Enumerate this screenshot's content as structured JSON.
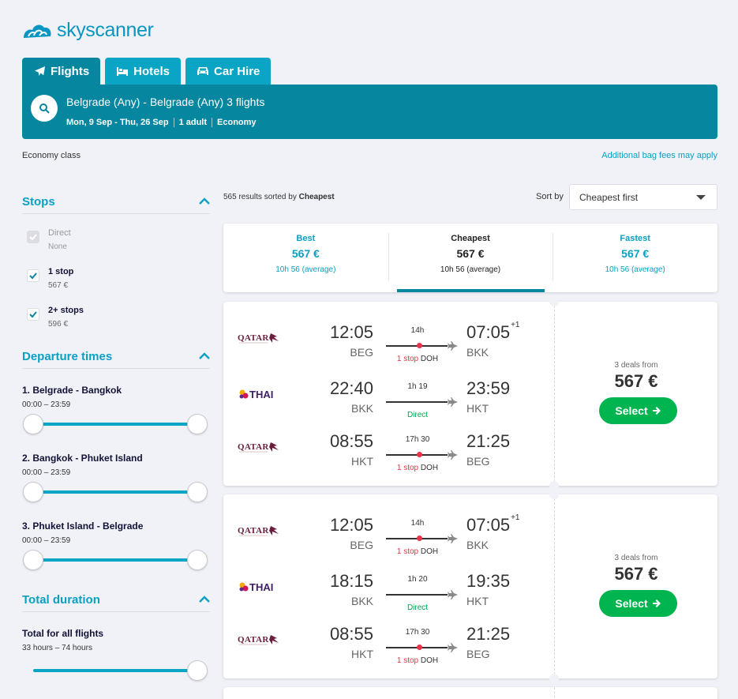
{
  "brand": {
    "name": "skyscanner",
    "color": "#0896c2"
  },
  "tabs": [
    {
      "label": "Flights",
      "icon": "plane-icon",
      "active": true
    },
    {
      "label": "Hotels",
      "icon": "bed-icon",
      "active": false
    },
    {
      "label": "Car Hire",
      "icon": "car-icon",
      "active": false
    }
  ],
  "search": {
    "route": "Belgrade (Any) - Belgrade (Any) 3 flights",
    "dates": "Mon, 9 Sep - Thu, 26 Sep",
    "travellers": "1 adult",
    "cabin": "Economy"
  },
  "notes": {
    "class": "Economy class",
    "bag_fees": "Additional bag fees may apply"
  },
  "filters": {
    "stops": {
      "title": "Stops",
      "options": [
        {
          "label": "Direct",
          "price": "None",
          "checked": true,
          "disabled": true
        },
        {
          "label": "1 stop",
          "price": "567 €",
          "checked": true,
          "disabled": false
        },
        {
          "label": "2+ stops",
          "price": "596 €",
          "checked": true,
          "disabled": false
        }
      ]
    },
    "departure": {
      "title": "Departure times",
      "legs": [
        {
          "label": "1. Belgrade - Bangkok",
          "range": "00:00 – 23:59"
        },
        {
          "label": "2. Bangkok - Phuket Island",
          "range": "00:00 – 23:59"
        },
        {
          "label": "3. Phuket Island - Belgrade",
          "range": "00:00 – 23:59"
        }
      ]
    },
    "duration": {
      "title": "Total duration",
      "label": "Total for all flights",
      "range": "33 hours – 74 hours"
    }
  },
  "results": {
    "count_prefix": "565 results sorted by",
    "sorted_by": "Cheapest",
    "sort_label": "Sort by",
    "sort_value": "Cheapest first"
  },
  "sort_tabs": [
    {
      "label": "Best",
      "price": "567 €",
      "duration": "10h 56 (average)",
      "active": false
    },
    {
      "label": "Cheapest",
      "price": "567 €",
      "duration": "10h 56 (average)",
      "active": true
    },
    {
      "label": "Fastest",
      "price": "567 €",
      "duration": "10h 56 (average)",
      "active": false
    }
  ],
  "itineraries": [
    {
      "deals": "3 deals from",
      "price": "567 €",
      "select": "Select",
      "legs": [
        {
          "airline": "QATAR",
          "dep_time": "12:05",
          "dep_airport": "BEG",
          "duration": "14h",
          "stops": "1 stop",
          "via": "DOH",
          "arr_time": "07:05",
          "plus": "+1",
          "arr_airport": "BKK"
        },
        {
          "airline": "THAI",
          "dep_time": "22:40",
          "dep_airport": "BKK",
          "duration": "1h 19",
          "stops": "Direct",
          "via": "",
          "arr_time": "23:59",
          "plus": "",
          "arr_airport": "HKT"
        },
        {
          "airline": "QATAR",
          "dep_time": "08:55",
          "dep_airport": "HKT",
          "duration": "17h 30",
          "stops": "1 stop",
          "via": "DOH",
          "arr_time": "21:25",
          "plus": "",
          "arr_airport": "BEG"
        }
      ]
    },
    {
      "deals": "3 deals from",
      "price": "567 €",
      "select": "Select",
      "legs": [
        {
          "airline": "QATAR",
          "dep_time": "12:05",
          "dep_airport": "BEG",
          "duration": "14h",
          "stops": "1 stop",
          "via": "DOH",
          "arr_time": "07:05",
          "plus": "+1",
          "arr_airport": "BKK"
        },
        {
          "airline": "THAI",
          "dep_time": "18:15",
          "dep_airport": "BKK",
          "duration": "1h 20",
          "stops": "Direct",
          "via": "",
          "arr_time": "19:35",
          "plus": "",
          "arr_airport": "HKT"
        },
        {
          "airline": "QATAR",
          "dep_time": "08:55",
          "dep_airport": "HKT",
          "duration": "17h 30",
          "stops": "1 stop",
          "via": "DOH",
          "arr_time": "21:25",
          "plus": "",
          "arr_airport": "BEG"
        }
      ]
    }
  ]
}
